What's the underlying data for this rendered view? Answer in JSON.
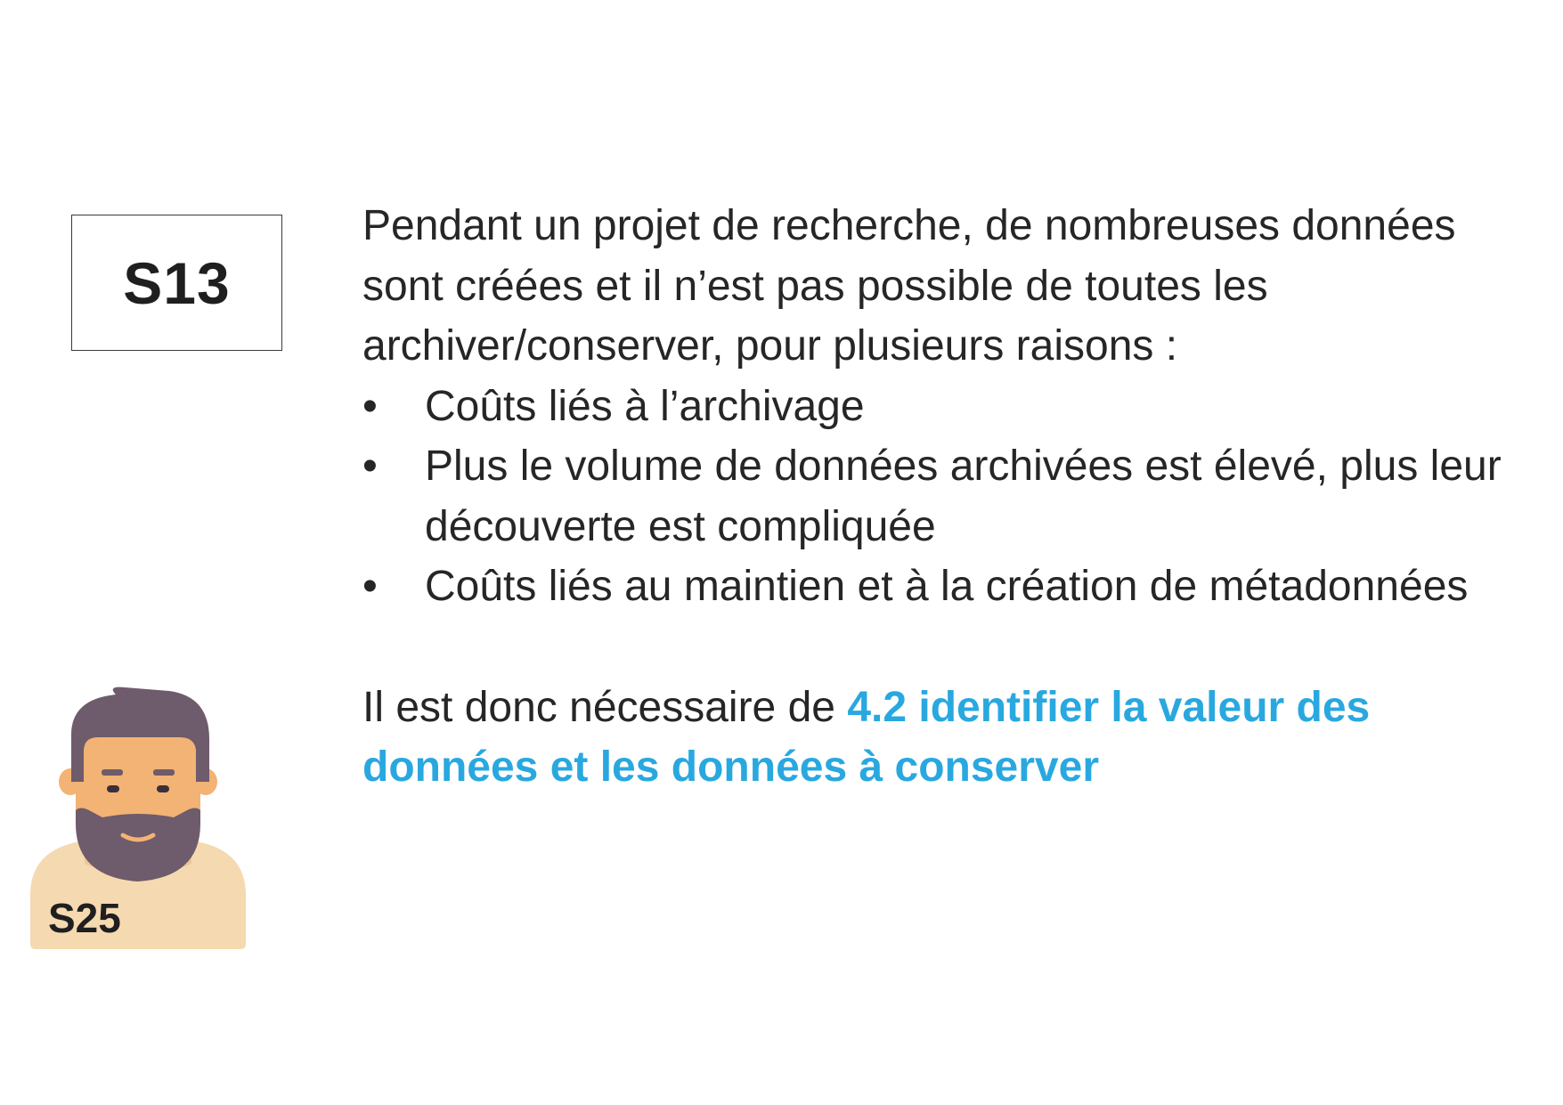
{
  "code": "S13",
  "intro": "Pendant un projet de recherche, de nombreuses données sont créées et il n’est pas possible de toutes les archiver/conserver, pour plusieurs raisons :",
  "bullet_glyph": "•",
  "bullets": [
    "Coûts liés à l’archivage",
    "Plus le volume de données archivées est élevé, plus leur découverte est compliquée",
    "Coûts liés au maintien et à la création de métadonnées"
  ],
  "conclusion": {
    "lead": "Il est donc nécessaire de ",
    "highlight": "4.2 identifier la valeur des données et les données à conserver"
  },
  "avatar": {
    "label": "S25",
    "icon": "bearded-man-avatar-icon"
  },
  "colors": {
    "highlight": "#29a8e0",
    "text": "#262626",
    "hair": "#6e5b6b",
    "skin": "#f2b374",
    "beard": "#6e5b6b",
    "sweater": "#f5d9b0"
  }
}
